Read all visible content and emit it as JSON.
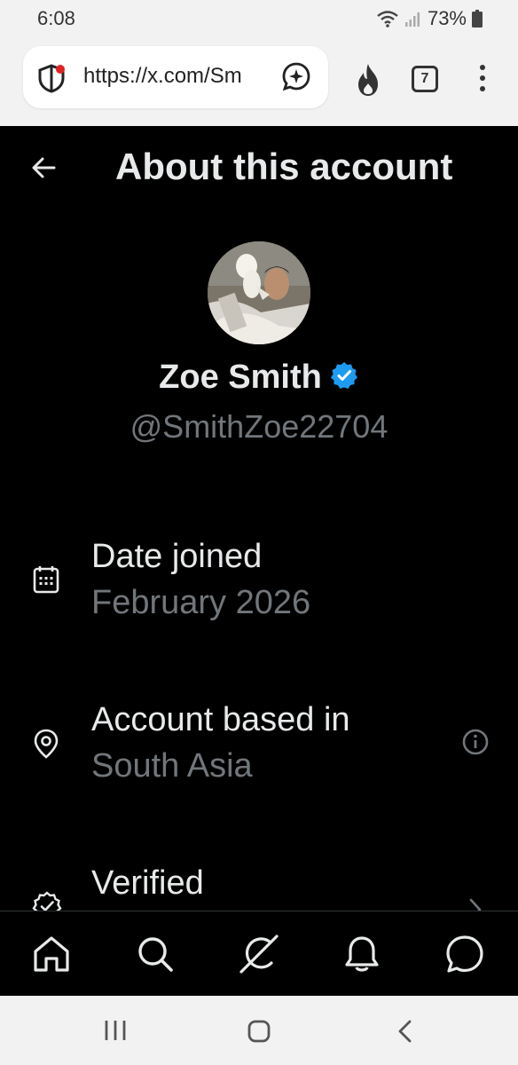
{
  "status_bar": {
    "time": "6:08",
    "battery": "73%"
  },
  "browser": {
    "url": "https://x.com/Sm",
    "tab_count": "7"
  },
  "header": {
    "title": "About this account"
  },
  "profile": {
    "display_name": "Zoe Smith",
    "handle": "@SmithZoe22704",
    "verified_color": "#1d9bf0"
  },
  "details": {
    "date_joined_label": "Date joined",
    "date_joined_value": "February 2026",
    "based_in_label": "Account based in",
    "based_in_value": "South Asia",
    "verified_label": "Verified"
  },
  "bottom_nav": {
    "items": [
      "home-icon",
      "search-icon",
      "grok-icon",
      "notifications-icon",
      "messages-icon"
    ]
  },
  "android_nav": {
    "items": [
      "recents-icon",
      "home-icon",
      "back-icon"
    ]
  }
}
